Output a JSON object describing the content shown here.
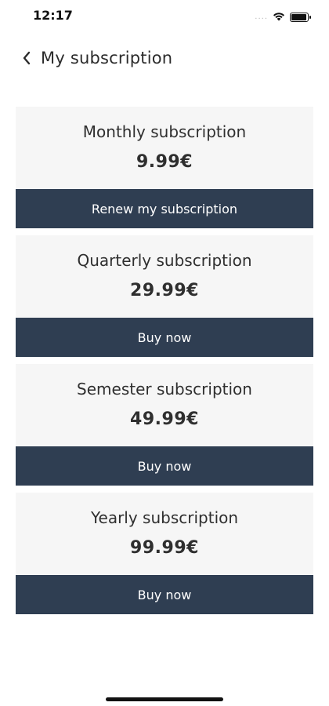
{
  "status_bar": {
    "time": "12:17",
    "signal": "....",
    "icons": [
      "wifi-icon",
      "battery-icon"
    ]
  },
  "header": {
    "back_icon": "chevron-left-icon",
    "title": "My subscription"
  },
  "plans": [
    {
      "name": "Monthly subscription",
      "price": "9.99€",
      "button_label": "Renew my subscription"
    },
    {
      "name": "Quarterly subscription",
      "price": "29.99€",
      "button_label": "Buy now"
    },
    {
      "name": "Semester subscription",
      "price": "49.99€",
      "button_label": "Buy now"
    },
    {
      "name": "Yearly subscription",
      "price": "99.99€",
      "button_label": "Buy now"
    }
  ],
  "colors": {
    "button_bg": "#2f3e52",
    "card_bg": "#f6f6f6",
    "text": "#2f2f2f"
  }
}
